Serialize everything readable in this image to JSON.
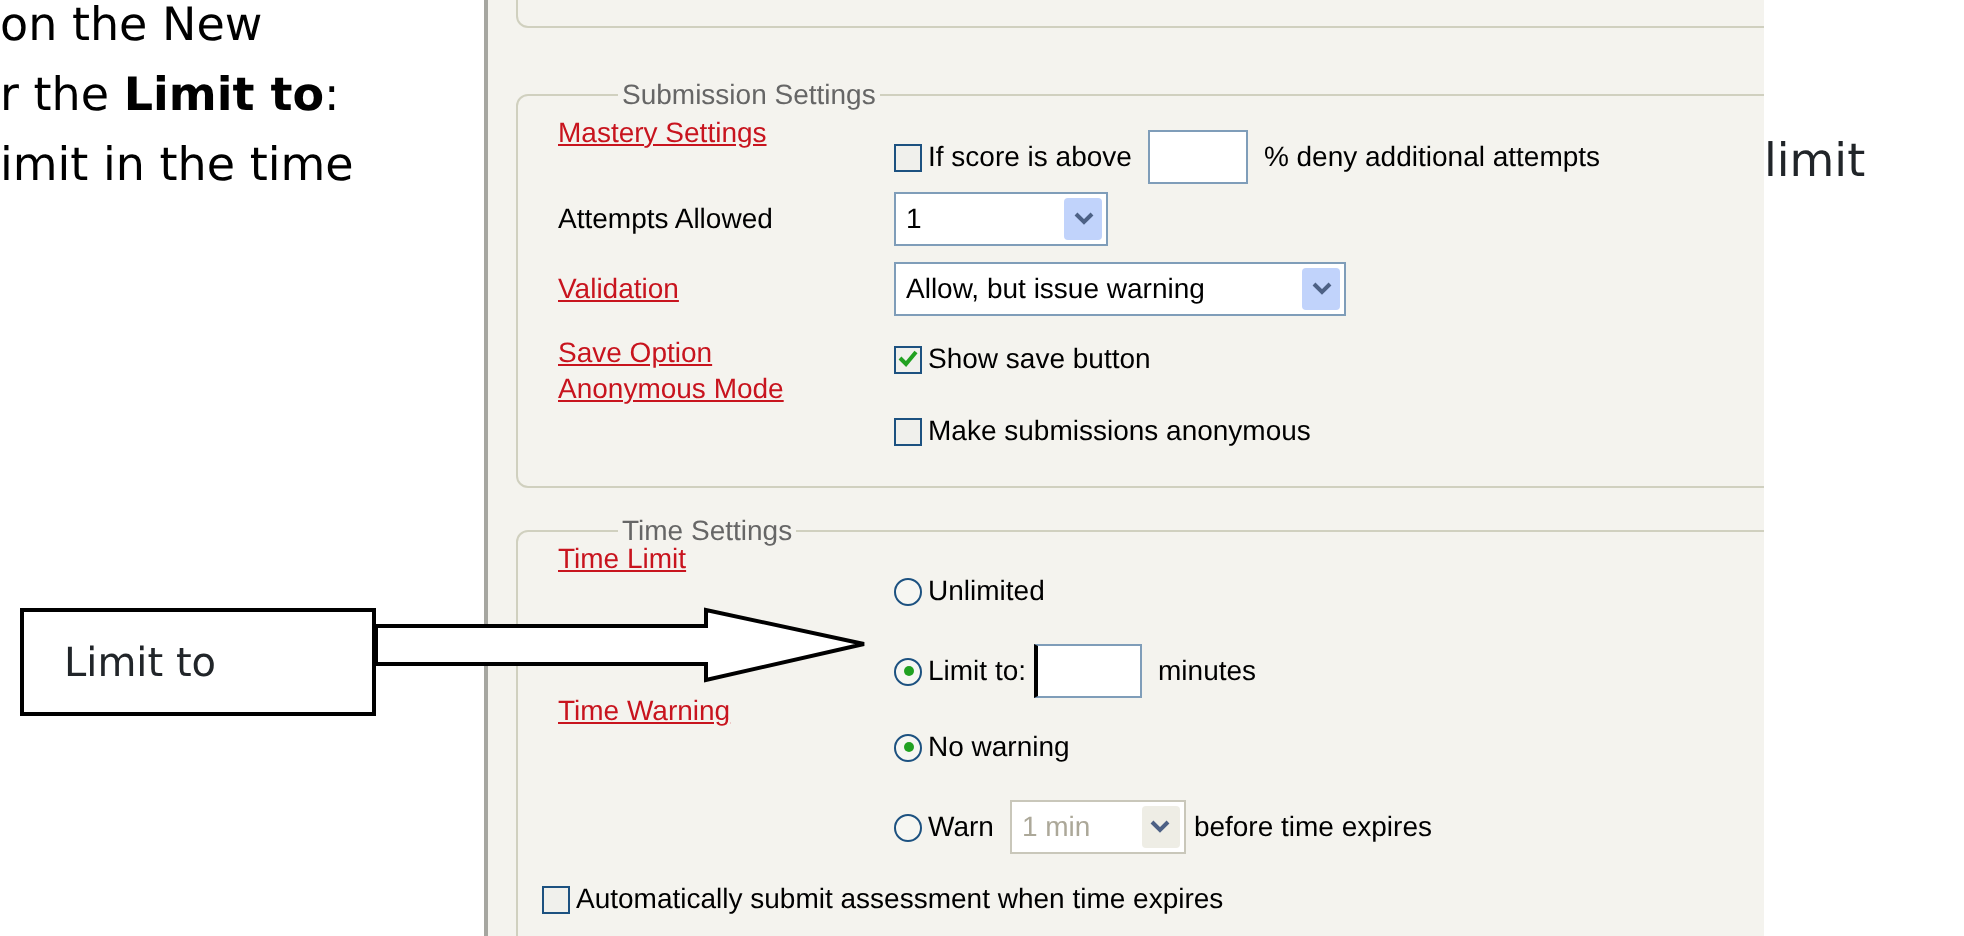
{
  "document": {
    "lines": [
      "on the New",
      "r the **Limit to**:",
      "imit in the time"
    ],
    "side_text": "limit"
  },
  "callout": {
    "label": "Limit to"
  },
  "submission_settings": {
    "legend": "Submission Settings",
    "mastery": {
      "label": "Mastery Settings",
      "checkbox": {
        "label": "If score is above",
        "checked": false
      },
      "suffix": "% deny additional attempts"
    },
    "attempts": {
      "label": "Attempts Allowed",
      "value": "1"
    },
    "validation": {
      "label": "Validation",
      "value": "Allow, but issue warning"
    },
    "save": {
      "labels": [
        "Save Option",
        "Anonymous Mode"
      ],
      "options": [
        {
          "label": "Show save button",
          "checked": true
        },
        {
          "label": "Make submissions anonymous",
          "checked": false
        }
      ]
    }
  },
  "time_settings": {
    "legend": "Time Settings",
    "time_limit": {
      "label": "Time Limit",
      "options": [
        {
          "label": "Unlimited",
          "selected": false
        },
        {
          "label": "Limit to:",
          "selected": true,
          "unit": "minutes"
        }
      ]
    },
    "time_warning": {
      "label": "Time Warning",
      "options": [
        {
          "label": "No warning",
          "selected": true
        },
        {
          "label": "Warn",
          "selected": false,
          "value": "1 min",
          "disabled": true,
          "suffix": "before time expires"
        }
      ]
    },
    "auto_submit": {
      "label": "Automatically submit assessment when time expires",
      "checked": false
    }
  }
}
